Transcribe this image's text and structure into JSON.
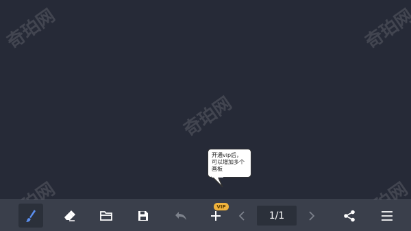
{
  "tooltip": {
    "text": "开通vip后，可以增加多个画板"
  },
  "toolbar": {
    "vip_badge": "VIP",
    "page_indicator": "1/1",
    "accent_color": "#5b8ff0",
    "vip_color": "#f0b33d",
    "icons": [
      "brush-icon",
      "eraser-icon",
      "folder-icon",
      "save-icon",
      "undo-icon",
      "add-icon",
      "chevron-left-icon",
      "chevron-right-icon",
      "share-icon",
      "menu-icon"
    ]
  },
  "watermark": {
    "text": "奇珀网"
  }
}
